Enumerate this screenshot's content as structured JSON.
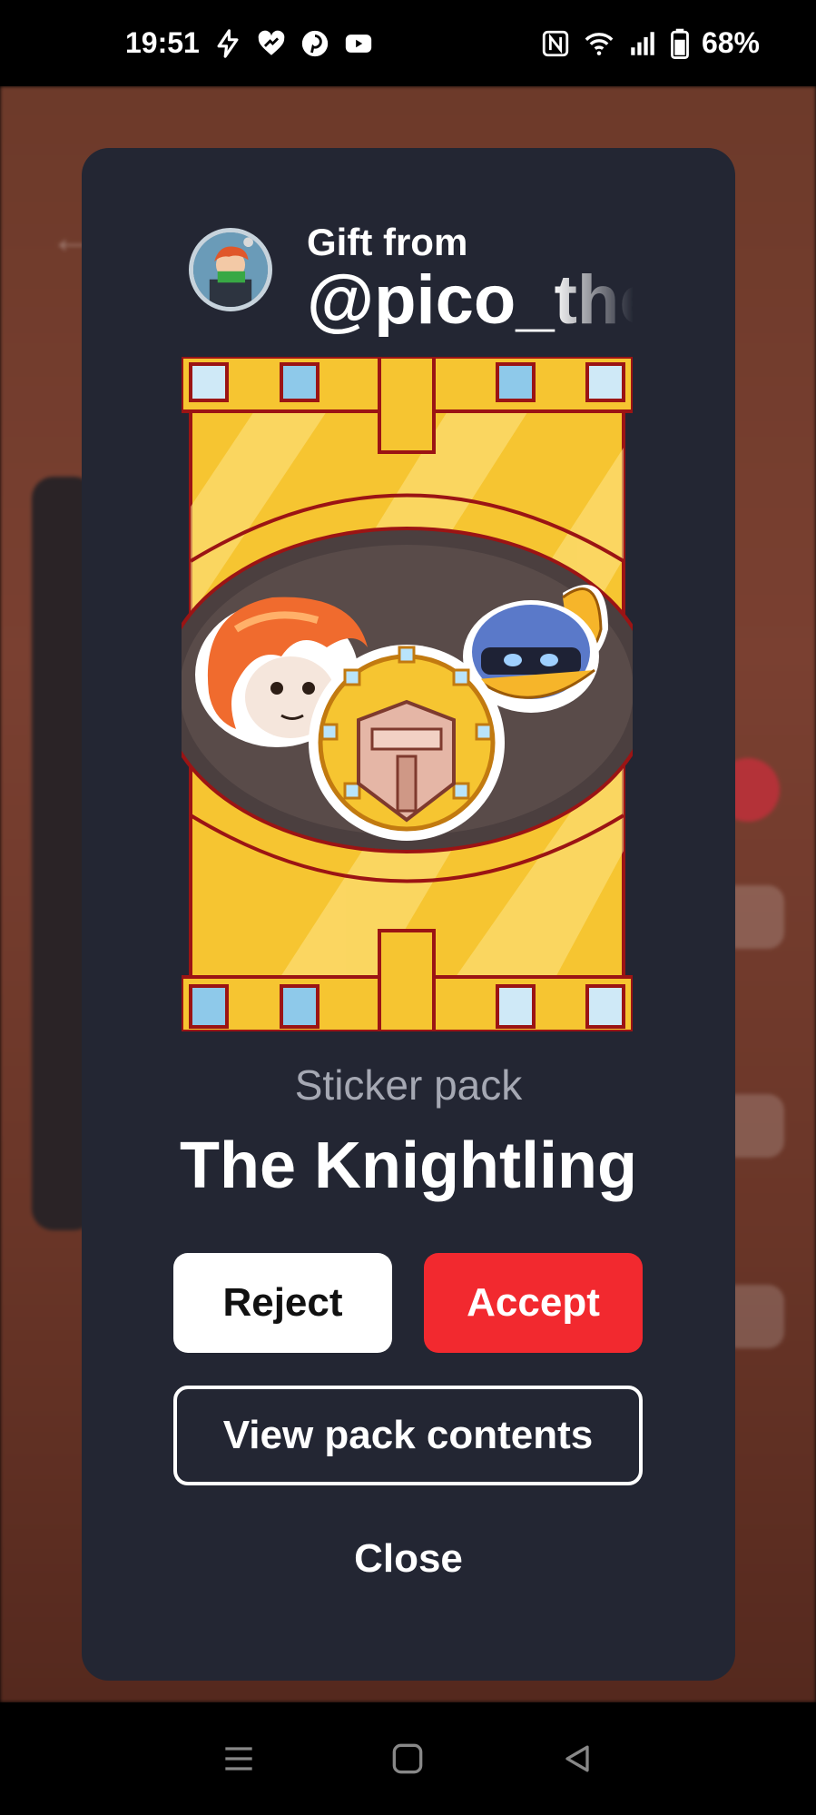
{
  "status_bar": {
    "time": "19:51",
    "battery": "68%",
    "left_icons": [
      "flash-icon",
      "heart-app-icon",
      "pinterest-icon",
      "youtube-icon"
    ],
    "right_icons": [
      "nfc-icon",
      "wifi-icon",
      "signal-icon",
      "battery-icon"
    ]
  },
  "dialog": {
    "gift_from_label": "Gift from",
    "sender_name": "@pico_the",
    "pack_type": "Sticker pack",
    "pack_title": "The Knightling",
    "reject_label": "Reject",
    "accept_label": "Accept",
    "view_contents_label": "View pack contents",
    "close_label": "Close"
  },
  "nav_bar": {
    "icons": [
      "recents-icon",
      "home-icon",
      "back-icon"
    ]
  },
  "colors": {
    "dialog_bg": "#232633",
    "accept_bg": "#f2292f",
    "reject_bg": "#ffffff",
    "pack_gold": "#f6c531"
  }
}
